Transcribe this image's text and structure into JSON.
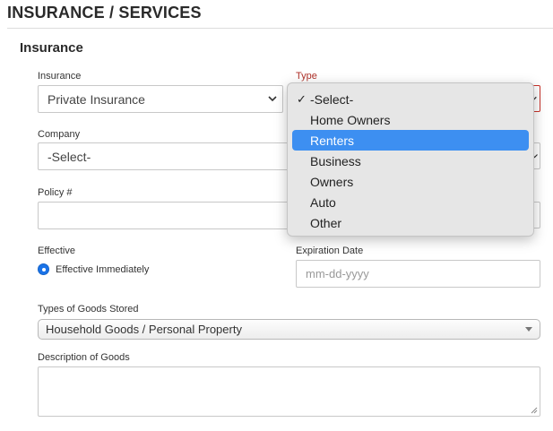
{
  "page": {
    "heading": "INSURANCE / SERVICES"
  },
  "section": {
    "title": "Insurance"
  },
  "insurance": {
    "label": "Insurance",
    "value": "Private Insurance"
  },
  "type": {
    "label": "Type",
    "options": [
      {
        "label": "-Select-",
        "checked": true
      },
      {
        "label": "Home Owners"
      },
      {
        "label": "Renters",
        "highlighted": true
      },
      {
        "label": "Business"
      },
      {
        "label": "Owners"
      },
      {
        "label": "Auto"
      },
      {
        "label": "Other"
      }
    ]
  },
  "company": {
    "label": "Company",
    "value": "-Select-"
  },
  "policy": {
    "label": "Policy #",
    "value": ""
  },
  "effective": {
    "label": "Effective",
    "option_label": "Effective Immediately",
    "selected": true
  },
  "expiration": {
    "label": "Expiration Date",
    "placeholder": "mm-dd-yyyy"
  },
  "goods": {
    "label": "Types of Goods Stored",
    "value": "Household Goods / Personal Property"
  },
  "description": {
    "label": "Description of Goods",
    "value": ""
  },
  "colors": {
    "highlight": "#3d8ff1",
    "error": "#b0322a",
    "radio": "#1a73e8"
  }
}
